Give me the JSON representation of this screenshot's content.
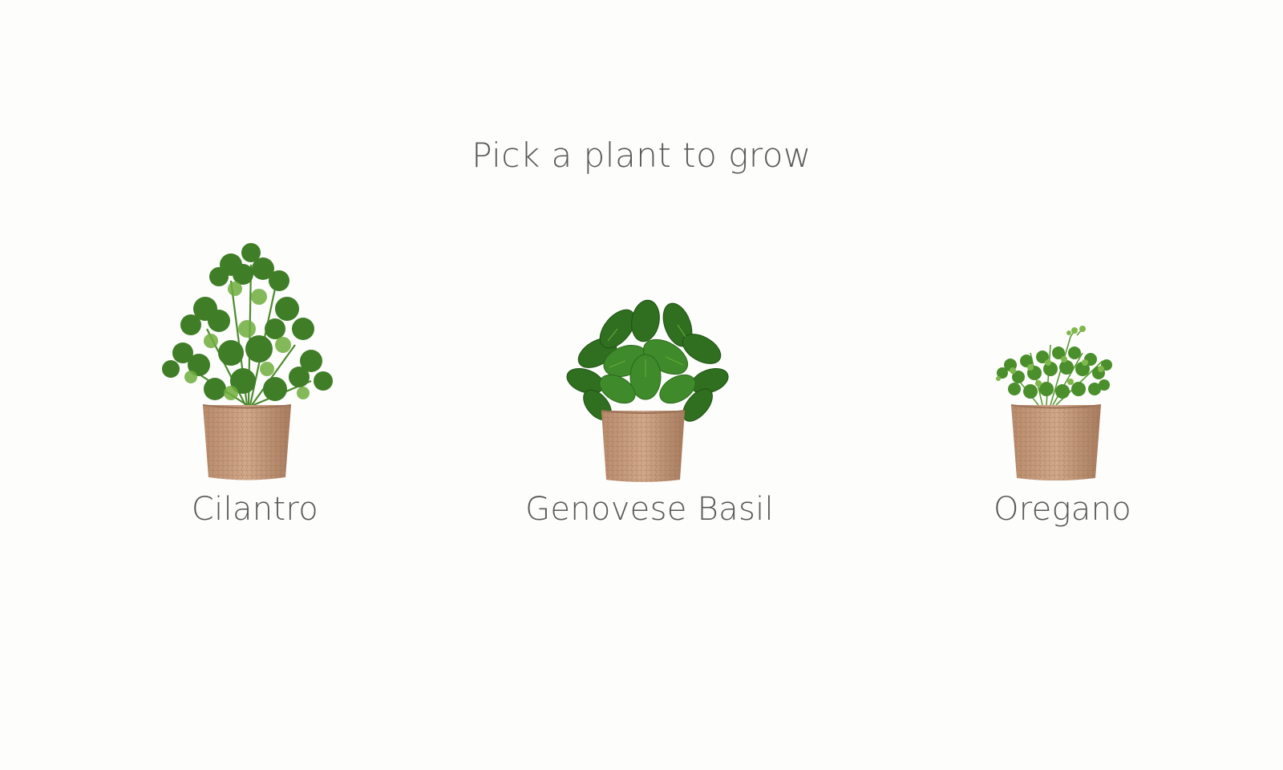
{
  "page": {
    "title": "Pick a plant to grow"
  },
  "plants": [
    {
      "name": "Cilantro",
      "icon": "cilantro-plant-icon"
    },
    {
      "name": "Genovese Basil",
      "icon": "basil-plant-icon"
    },
    {
      "name": "Oregano",
      "icon": "oregano-plant-icon"
    }
  ],
  "colors": {
    "background": "#fdfdfc",
    "text": "#585858",
    "leaf_dark": "#2f6f1f",
    "leaf_mid": "#4a8f2c",
    "leaf_light": "#7fb84a",
    "pot": "#c59a7a",
    "pot_dark": "#9c7259"
  }
}
